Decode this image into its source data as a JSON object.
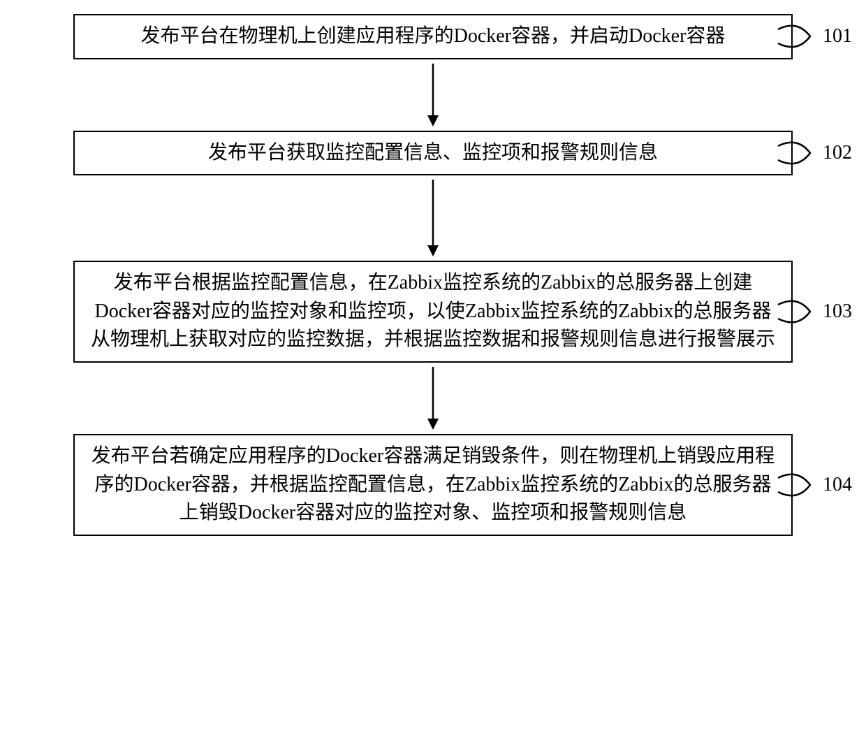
{
  "steps": [
    {
      "label": "101",
      "text": "发布平台在物理机上创建应用程序的Docker容器，并启动Docker容器"
    },
    {
      "label": "102",
      "text": "发布平台获取监控配置信息、监控项和报警规则信息"
    },
    {
      "label": "103",
      "text": "发布平台根据监控配置信息，在Zabbix监控系统的Zabbix的总服务器上创建Docker容器对应的监控对象和监控项，以使Zabbix监控系统的Zabbix的总服务器从物理机上获取对应的监控数据，并根据监控数据和报警规则信息进行报警展示"
    },
    {
      "label": "104",
      "text": "发布平台若确定应用程序的Docker容器满足销毁条件，则在物理机上销毁应用程序的Docker容器，并根据监控配置信息，在Zabbix监控系统的Zabbix的总服务器上销毁Docker容器对应的监控对象、监控项和报警规则信息"
    }
  ]
}
